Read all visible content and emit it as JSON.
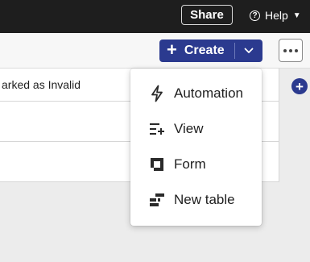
{
  "topbar": {
    "share_label": "Share",
    "help_label": "Help"
  },
  "toolbar": {
    "create_label": "Create"
  },
  "grid": {
    "header_text": "arked as Invalid"
  },
  "create_menu": {
    "items": [
      {
        "label": "Automation",
        "icon": "lightning-bolt-icon"
      },
      {
        "label": "View",
        "icon": "list-add-icon"
      },
      {
        "label": "Form",
        "icon": "form-icon"
      },
      {
        "label": "New table",
        "icon": "table-icon"
      }
    ]
  },
  "colors": {
    "accent": "#2b3a8f",
    "topbar_bg": "#1e1e1e"
  }
}
